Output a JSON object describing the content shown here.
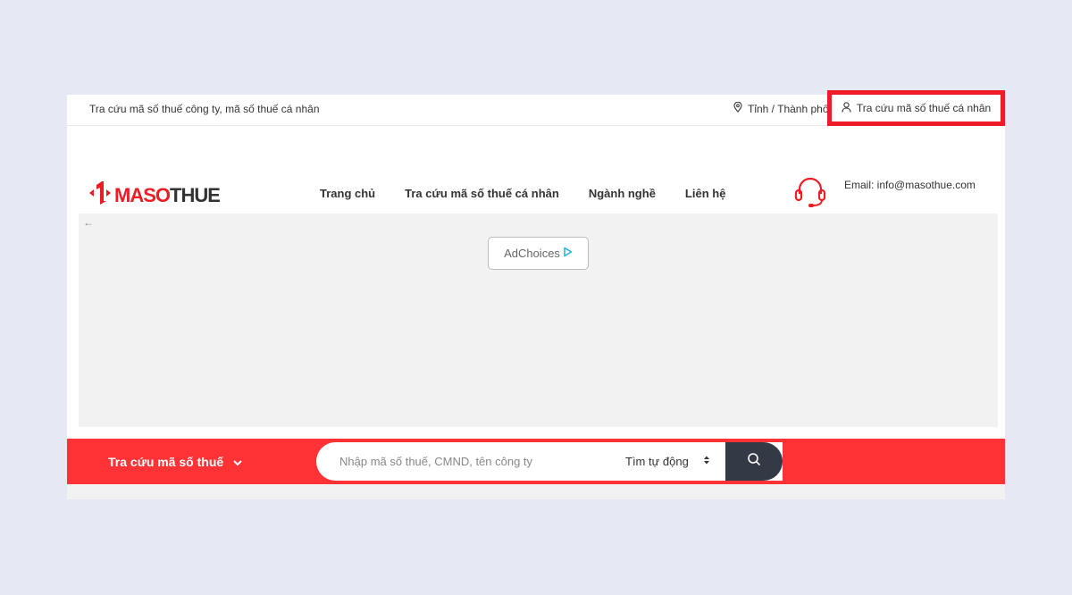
{
  "topbar": {
    "tagline": "Tra cứu mã số thuế công ty, mã số thuế cá nhân",
    "location_label": "Tỉnh / Thành phố",
    "personal_lookup_label": "Tra cứu mã số thuế cá nhân"
  },
  "header": {
    "logo_maso": "MASO",
    "logo_thue": "THUE",
    "nav": [
      "Trang chủ",
      "Tra cứu mã số thuế cá nhân",
      "Ngành nghề",
      "Liên hệ"
    ],
    "email": "Email: info@masothue.com"
  },
  "ad": {
    "label": "AdChoices"
  },
  "search": {
    "dropdown_label": "Tra cứu mã số thuế",
    "placeholder": "Nhập mã số thuế, CMND, tên công ty",
    "mode_label": "Tìm tự động"
  },
  "colors": {
    "accent": "#ff3236",
    "highlight_border": "#ee1c25",
    "search_button": "#343a45"
  }
}
